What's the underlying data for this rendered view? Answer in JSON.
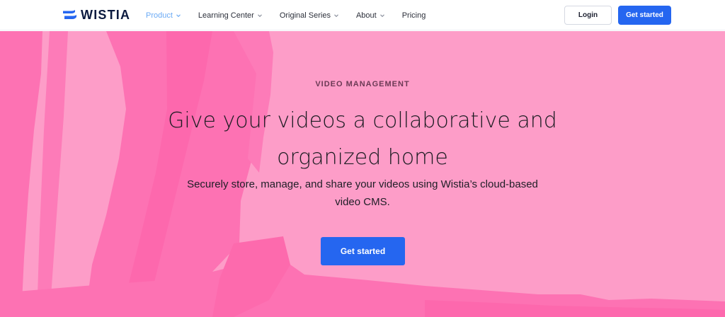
{
  "nav": {
    "brand": "WISTIA",
    "items": [
      {
        "label": "Product",
        "has_dropdown": true,
        "active": true
      },
      {
        "label": "Learning Center",
        "has_dropdown": true,
        "active": false
      },
      {
        "label": "Original Series",
        "has_dropdown": true,
        "active": false
      },
      {
        "label": "About",
        "has_dropdown": true,
        "active": false
      },
      {
        "label": "Pricing",
        "has_dropdown": false,
        "active": false
      }
    ],
    "login_label": "Login",
    "cta_label": "Get started"
  },
  "hero": {
    "eyebrow": "VIDEO MANAGEMENT",
    "headline": "Give your videos a collaborative and organized home",
    "subhead": "Securely store, manage, and share your videos using Wistia’s cloud-based video CMS.",
    "cta_label": "Get started"
  },
  "colors": {
    "brand_navy": "#0b1a3f",
    "brand_blue": "#2566f0",
    "nav_active": "#6aaaf5",
    "hero_pink": "#fd9dc8",
    "hero_pink_dark": "#fd72b3"
  }
}
